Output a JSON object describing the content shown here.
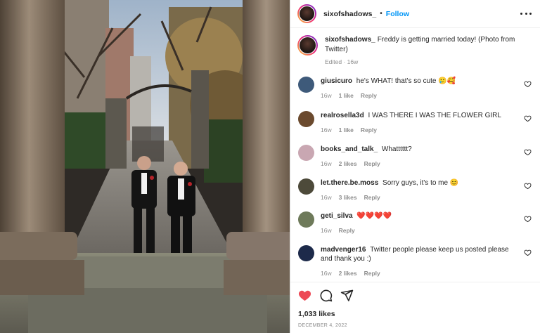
{
  "post": {
    "username": "sixofshadows_",
    "separator": "•",
    "follow_label": "Follow",
    "more_icon": "more-options-icon",
    "caption": {
      "username": "sixofshadows_",
      "text": "Freddy is getting married today! (Photo from Twitter)",
      "meta": "Edited · 16w"
    },
    "photo_description_icon": "post-photo"
  },
  "comments": [
    {
      "username": "giusicuro",
      "text": "he's WHAT! that's so cute 🥲🥰",
      "age": "16w",
      "likes": "1 like",
      "reply": "Reply",
      "avatar_color": "#3e5a7a"
    },
    {
      "username": "realrosella3d",
      "text": "I WAS THERE I WAS THE FLOWER GIRL",
      "age": "16w",
      "likes": "1 like",
      "reply": "Reply",
      "avatar_color": "#6b4a2e"
    },
    {
      "username": "books_and_talk_",
      "text": "Whatttttt?",
      "age": "16w",
      "likes": "2 likes",
      "reply": "Reply",
      "avatar_color": "#c9a7b2"
    },
    {
      "username": "let.there.be.moss",
      "text": "Sorry guys, it's to me 😊",
      "age": "16w",
      "likes": "3 likes",
      "reply": "Reply",
      "avatar_color": "#4d4a3a"
    },
    {
      "username": "geti_silva",
      "text": "❤️❤️❤️❤️",
      "age": "16w",
      "likes": "",
      "reply": "Reply",
      "avatar_color": "#6e7a5a"
    },
    {
      "username": "madvenger16",
      "text": "Twitter people please keep us posted please and thank you :)",
      "age": "16w",
      "likes": "2 likes",
      "reply": "Reply",
      "avatar_color": "#1d2a4a"
    }
  ],
  "actions": {
    "like_icon": "heart-filled-icon",
    "comment_icon": "comment-icon",
    "share_icon": "share-icon",
    "like_color": "#ed4956",
    "likes_total": "1,033 likes",
    "date": "DECEMBER 4, 2022"
  },
  "colors": {
    "link_blue": "#0095f6",
    "muted": "#8e8e8e",
    "text": "#262626"
  }
}
